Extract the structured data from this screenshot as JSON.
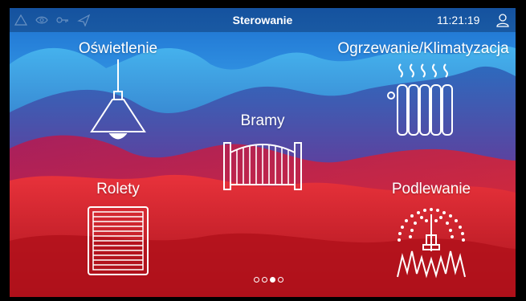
{
  "header": {
    "title": "Sterowanie",
    "time": "11:21:19"
  },
  "status_icons": [
    "warning-icon",
    "eye-icon",
    "key-icon",
    "plane-icon"
  ],
  "tiles": [
    {
      "label": "Oświetlenie",
      "icon": "lamp-icon"
    },
    {
      "label": "Ogrzewanie/Klimatyzacja",
      "icon": "radiator-icon"
    },
    {
      "label": "Bramy",
      "icon": "gate-icon"
    },
    {
      "label": "Rolety",
      "icon": "blinds-icon"
    },
    {
      "label": "Podlewanie",
      "icon": "sprinkler-icon"
    }
  ],
  "pagination": {
    "pages": 4,
    "active": 3
  },
  "colors": {
    "accent": "#ffffff",
    "sky": "#2f8fe0",
    "red": "#d8202e"
  }
}
